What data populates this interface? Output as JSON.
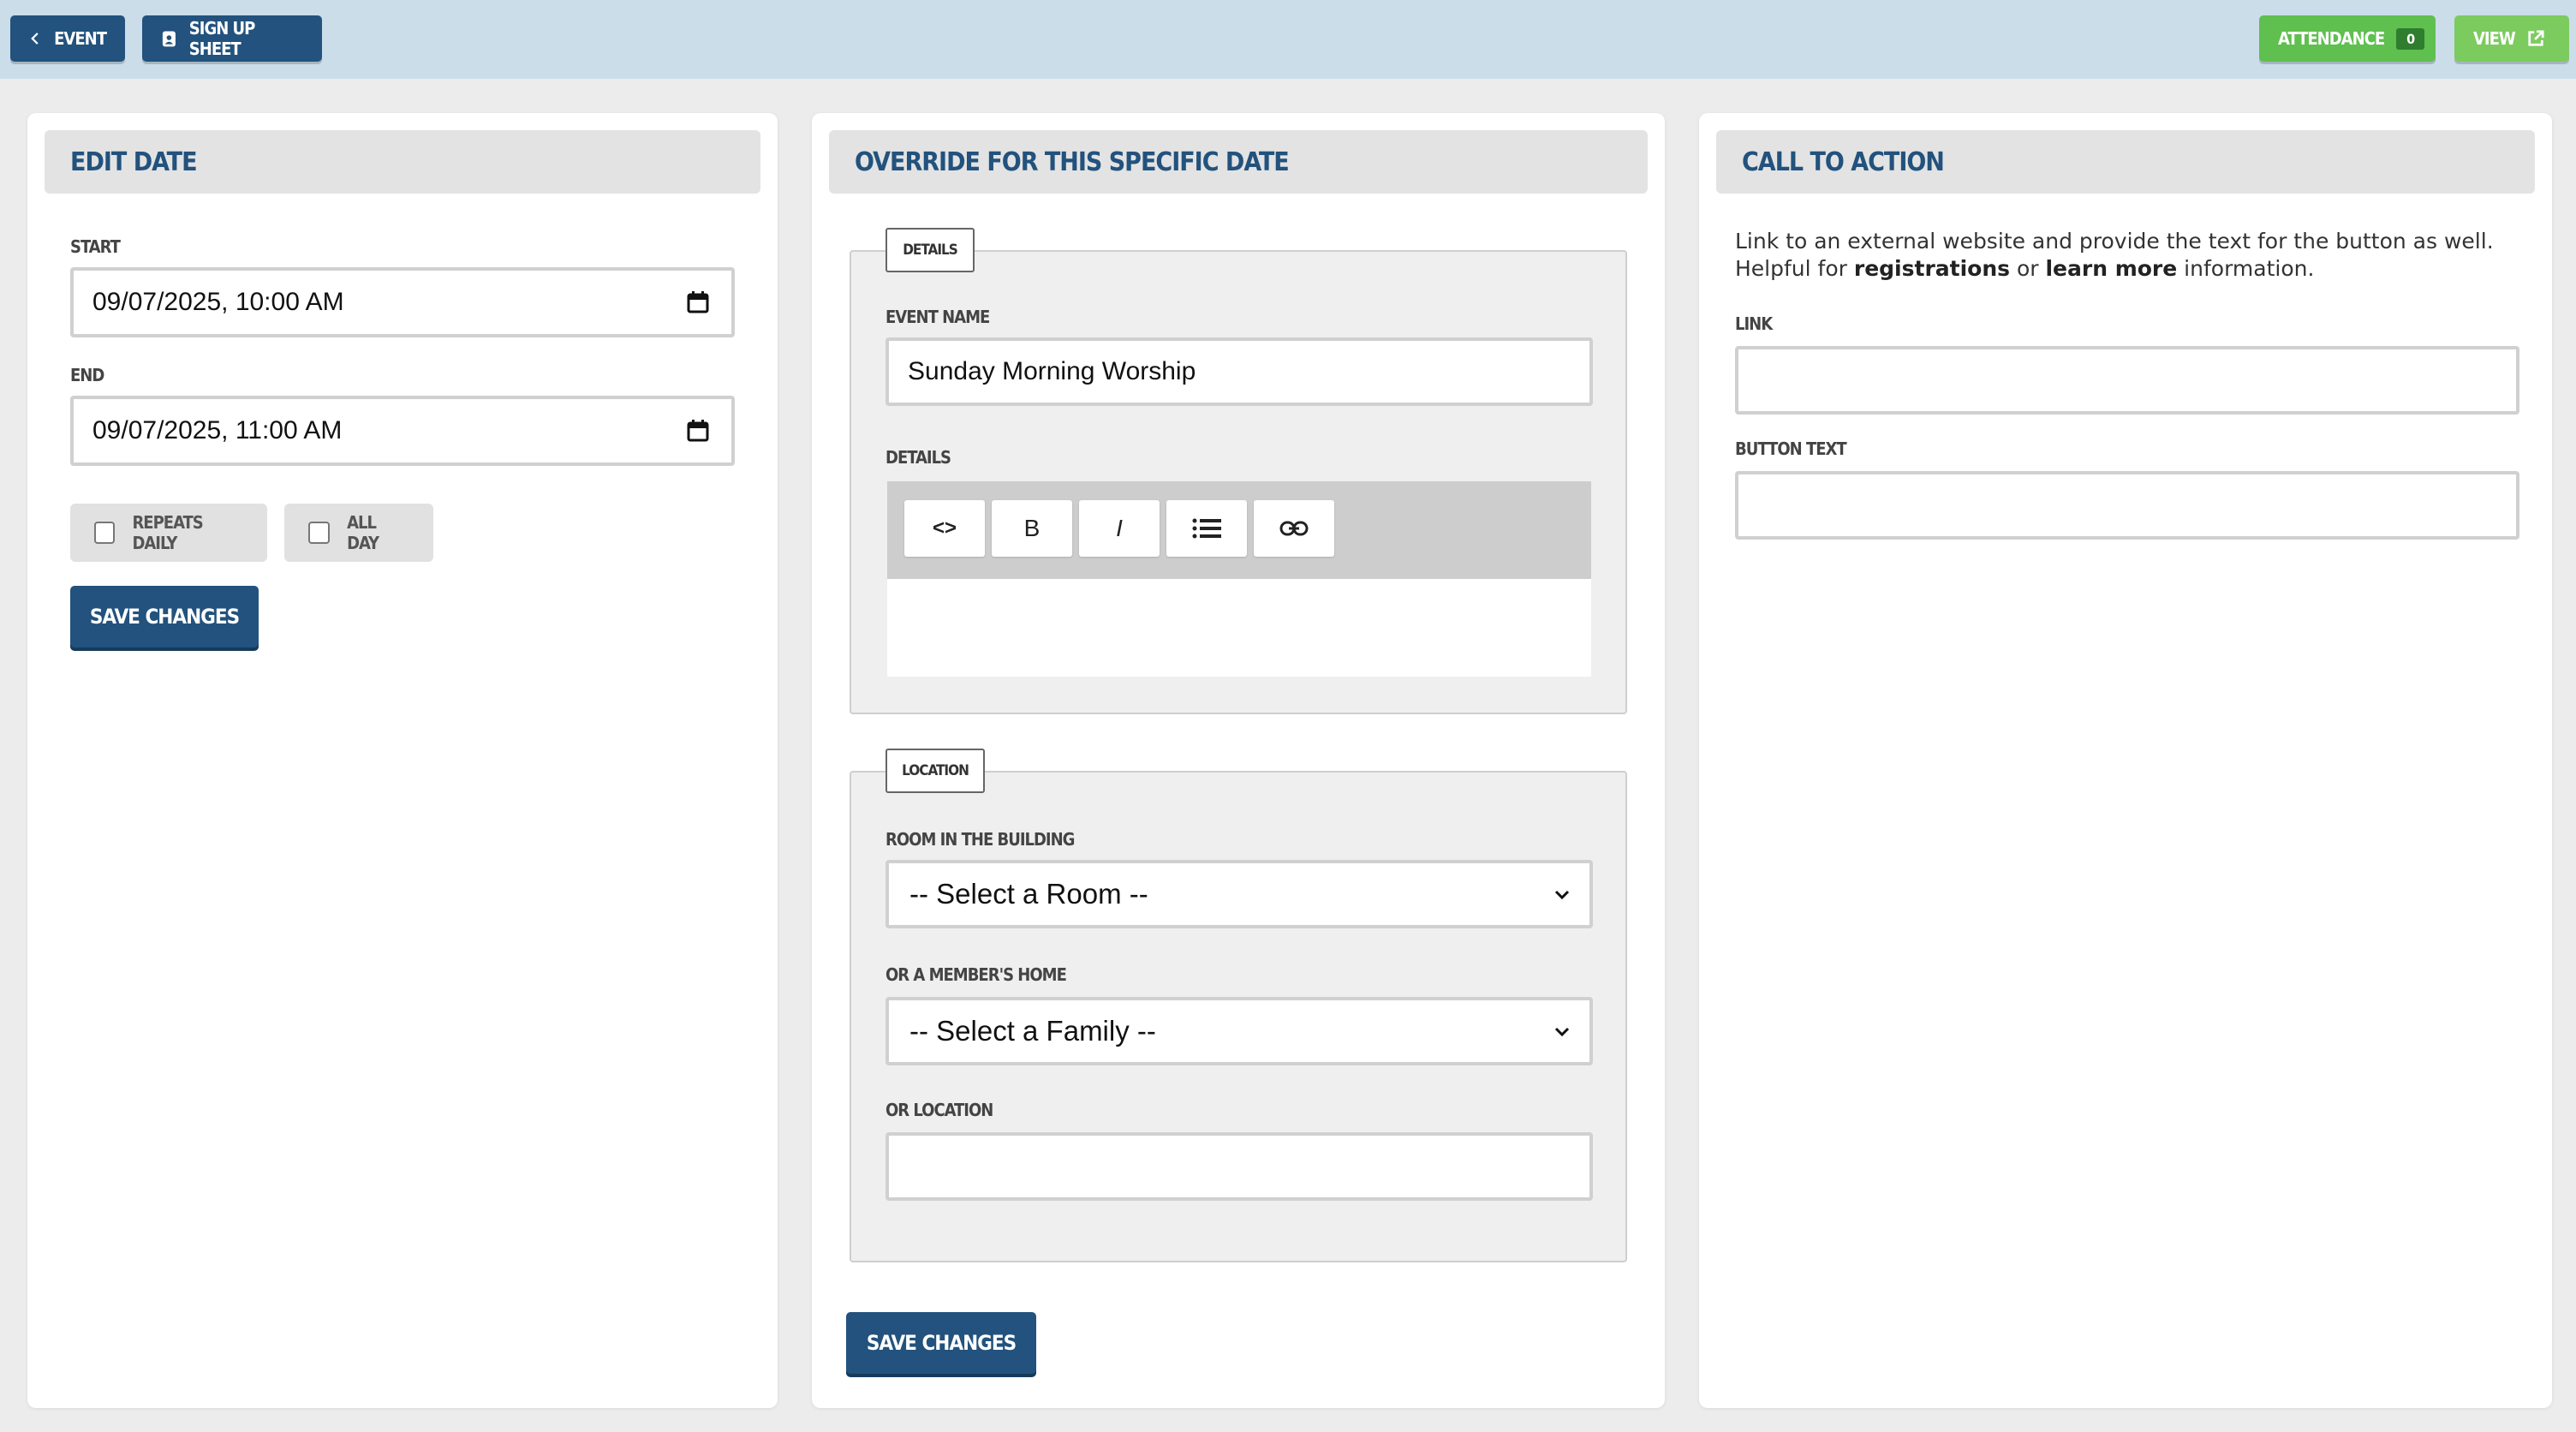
{
  "topbar": {
    "back_label": "EVENT",
    "signup_label": "SIGN UP SHEET",
    "attendance_label": "ATTENDANCE",
    "attendance_count": "0",
    "view_label": "VIEW",
    "bg_color": "#cbdde9"
  },
  "edit_date": {
    "title": "EDIT DATE",
    "start_label": "START",
    "start_value": "09/07/2025, 10:00 AM",
    "end_label": "END",
    "end_value": "09/07/2025, 11:00 AM",
    "repeats_label": "REPEATS DAILY",
    "allday_label": "ALL DAY",
    "save_label": "SAVE CHANGES"
  },
  "override": {
    "title": "OVERRIDE FOR THIS SPECIFIC DATE",
    "details_legend": "DETAILS",
    "event_name_label": "EVENT NAME",
    "event_name_value": "Sunday Morning Worship",
    "details_label": "DETAILS",
    "toolbar": {
      "code": "<>",
      "bold": "B",
      "italic": "I"
    },
    "location_legend": "LOCATION",
    "room_label": "ROOM IN THE BUILDING",
    "room_value": "-- Select a Room --",
    "home_label": "OR A MEMBER'S HOME",
    "home_value": "-- Select a Family --",
    "location_label": "OR LOCATION",
    "location_value": "",
    "save_label": "SAVE CHANGES"
  },
  "cta": {
    "title": "CALL TO ACTION",
    "desc_line1": "Link to an external website and provide the text for the button as well.",
    "desc_prefix": "Helpful for ",
    "desc_bold1": "registrations",
    "desc_mid": " or ",
    "desc_bold2": "learn more",
    "desc_suffix": " information.",
    "link_label": "LINK",
    "link_value": "",
    "button_text_label": "BUTTON TEXT",
    "button_text_value": ""
  },
  "colors": {
    "primary": "#22527d",
    "success": "#5fbf4f",
    "panel_head_bg": "#e3e3e3"
  }
}
